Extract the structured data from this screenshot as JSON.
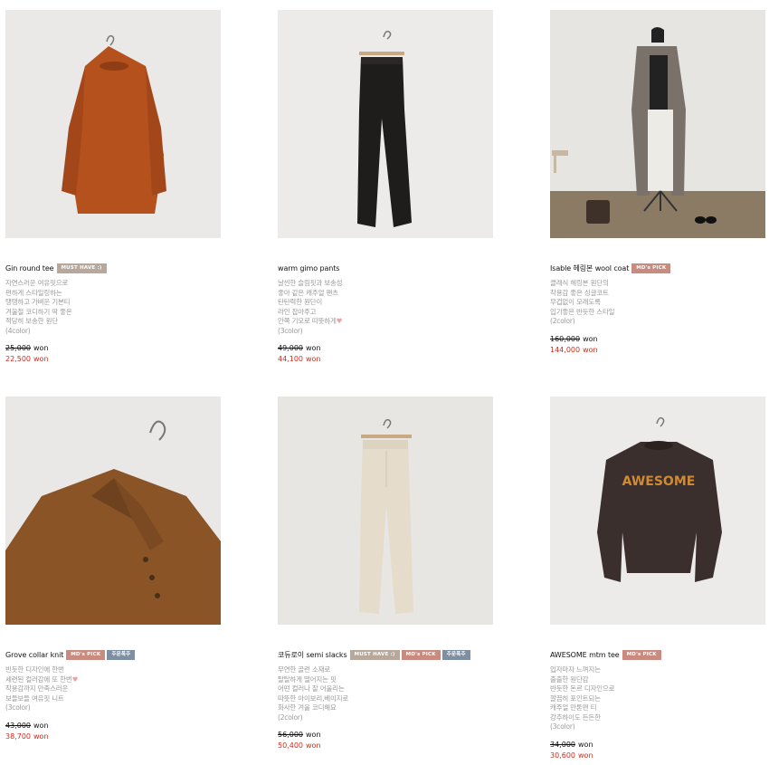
{
  "colors": {
    "must_have": "#b8a89c",
    "md_pick": "#c98b7f",
    "order": "#7e8fa3",
    "sale": "#d02b1b"
  },
  "currency_label": "won",
  "products": [
    {
      "name": "Gin round tee",
      "badges": [
        "MUST HAVE :)"
      ],
      "description": [
        "자연스러운 여유핏으로",
        "편하게 스타일링하는",
        "탱탱하고 가벼운 기본티",
        "겨울철 코디하기 딱 좋은",
        "적당히 보송한 원단",
        "(4color)"
      ],
      "original_price": "25,000",
      "sale_price": "22,500"
    },
    {
      "name": "warm gimo pants",
      "badges": [],
      "description": [
        "날씬한 슬림핏과 보송성",
        "좋아 같은 캐주얼 팬츠",
        "탄탄력한 원단이",
        "라인 잡아주고",
        "안쪽 기모로 따뜻하게♥",
        "(3color)"
      ],
      "original_price": "49,000",
      "sale_price": "44,100"
    },
    {
      "name": "Isable 헤링본 wool coat",
      "badges": [
        "MD's PICK"
      ],
      "description": [
        "클래식 헤링본 원단의",
        "착용감 좋은 싱글코트",
        "무겁없이 모래도록",
        "입기좋은 반듯한 스타일",
        "(2color)"
      ],
      "original_price": "160,000",
      "sale_price": "144,000"
    },
    {
      "name": "Grove collar knit",
      "badges": [
        "MD's PICK",
        "주문폭주"
      ],
      "description": [
        "빈듯한 디자인에 한번",
        "세련된 컬러감에 또 한번♥",
        "착용감까지 만족스러운",
        "보들보들 여유핏 니트",
        "(3color)"
      ],
      "original_price": "43,000",
      "sale_price": "38,700"
    },
    {
      "name": "코듀로이 semi slacks",
      "badges": [
        "MUST HAVE :)",
        "MD's PICK",
        "주문폭주"
      ],
      "description": [
        "무연한 골런 소재로",
        "탈탈하게 떨어지는 핏",
        "어떤 컬러나 잘 어울리는",
        "따뜻한 아이보리,베이지로",
        "화사한 겨울 코디해요",
        "(2color)"
      ],
      "original_price": "56,000",
      "sale_price": "50,400"
    },
    {
      "name": "AWESOME mtm tee",
      "badges": [
        "MD's PICK"
      ],
      "description": [
        "입자마자 느껴지는",
        "출출한 원단감",
        "반듯한 돈르 디자인으로",
        "깔끔히 포인트되는",
        "캐주얼 만톤맨 티",
        "강추하이도 든든한",
        "(3color)"
      ],
      "original_price": "34,000",
      "sale_price": "30,600"
    }
  ]
}
